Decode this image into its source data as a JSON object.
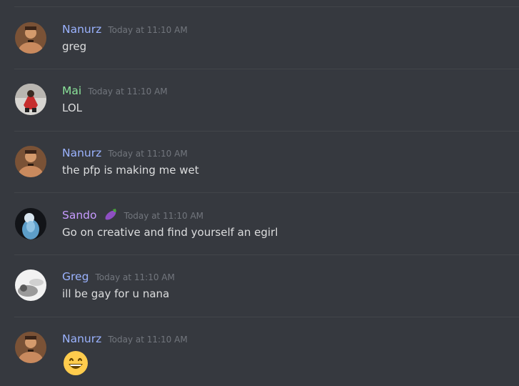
{
  "colors": {
    "background": "#36393f",
    "divider": "#42454a",
    "timestamp": "#72767d",
    "message_text": "#dcddde",
    "name_blue": "#9bb3ff",
    "name_green": "#8be39a",
    "name_purple": "#c79bff"
  },
  "messages": [
    {
      "author": "Nanurz",
      "author_color": "#9bb3ff",
      "avatar": "shirtless-man-avatar",
      "timestamp": "Today at 11:10 AM",
      "text": "greg"
    },
    {
      "author": "Mai",
      "author_color": "#8be39a",
      "avatar": "red-jacket-person-avatar",
      "timestamp": "Today at 11:10 AM",
      "text": "LOL"
    },
    {
      "author": "Nanurz",
      "author_color": "#9bb3ff",
      "avatar": "shirtless-man-avatar",
      "timestamp": "Today at 11:10 AM",
      "text": "the pfp is making me wet"
    },
    {
      "author": "Sando",
      "author_color": "#c79bff",
      "author_emoji": "eggplant-emoji",
      "avatar": "blue-figure-avatar",
      "timestamp": "Today at 11:10 AM",
      "text": "Go on creative and find yourself an egirl"
    },
    {
      "author": "Greg",
      "author_color": "#9bb3ff",
      "avatar": "grayscale-photo-avatar",
      "timestamp": "Today at 11:10 AM",
      "text": "ill be gay for u nana"
    },
    {
      "author": "Nanurz",
      "author_color": "#9bb3ff",
      "avatar": "shirtless-man-avatar",
      "timestamp": "Today at 11:10 AM",
      "emoji": "grinning-face-emoji"
    }
  ]
}
